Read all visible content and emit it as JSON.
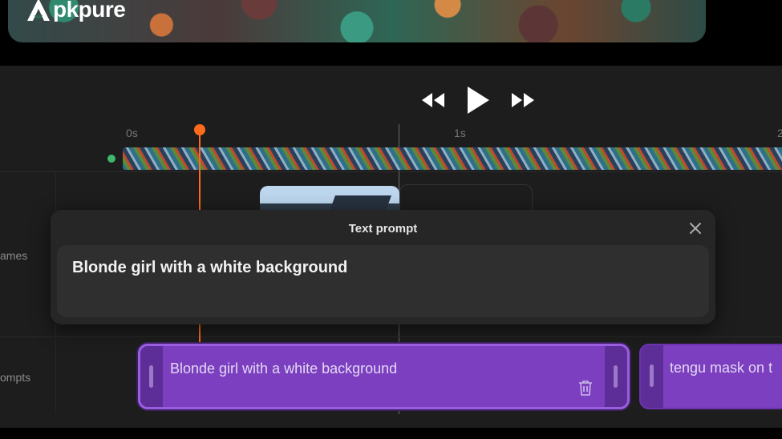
{
  "app": {
    "logo_text": "pkpure"
  },
  "player": {
    "icons": [
      "rewind-icon",
      "play-icon",
      "fast-forward-icon"
    ]
  },
  "timeline": {
    "ruler_labels": [
      "0s",
      "1s",
      "2"
    ]
  },
  "tracks": {
    "labels": [
      "ames",
      "ompts"
    ]
  },
  "modal": {
    "title": "Text prompt",
    "prompt_value": "Blonde girl with a white background"
  },
  "clips": [
    {
      "text": "Blonde girl with a white background"
    },
    {
      "text": "tengu mask on t"
    }
  ],
  "colors": {
    "playhead": "#ff6b1a",
    "clip": "#7b3fbf",
    "start_marker": "#3fb86b"
  }
}
